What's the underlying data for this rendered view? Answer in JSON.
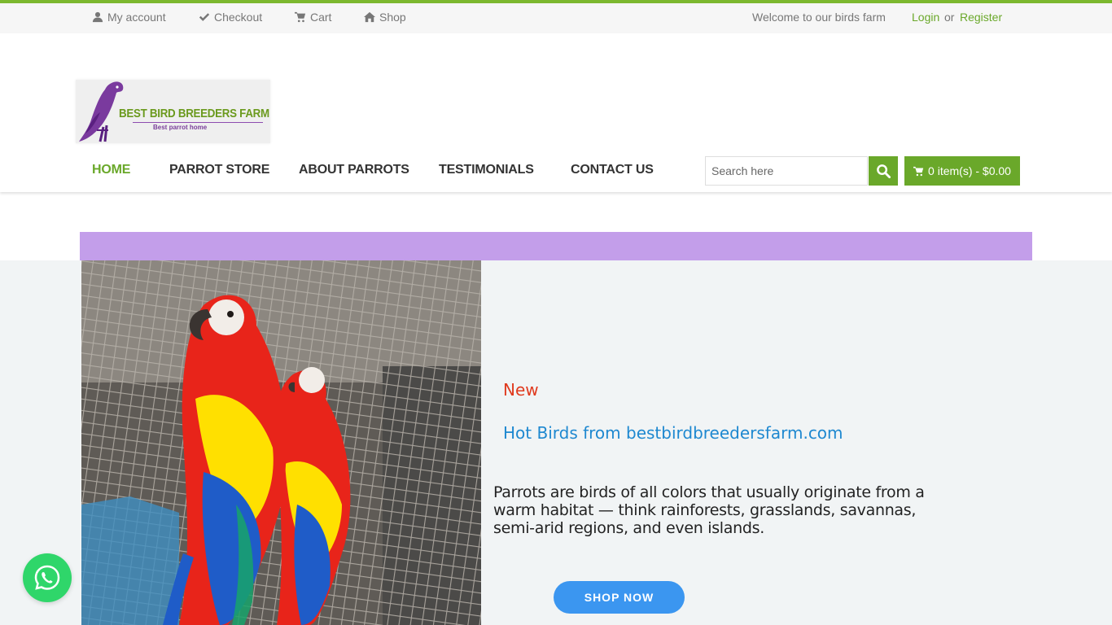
{
  "topbar": {
    "my_account": "My account",
    "checkout": "Checkout",
    "cart": "Cart",
    "shop": "Shop",
    "welcome": "Welcome to our birds farm",
    "login": "Login",
    "or": "or",
    "register": "Register"
  },
  "logo": {
    "title": "BEST BIRD BREEDERS FARM",
    "tagline": "Best parrot home"
  },
  "nav": {
    "items": [
      {
        "label": "HOME",
        "active": true
      },
      {
        "label": "PARROT STORE",
        "active": false
      },
      {
        "label": "ABOUT PARROTS",
        "active": false
      },
      {
        "label": "TESTIMONIALS",
        "active": false
      },
      {
        "label": "CONTACT US",
        "active": false
      }
    ]
  },
  "search": {
    "placeholder": "Search here"
  },
  "cart": {
    "summary": "0 item(s) - $0.00"
  },
  "hero": {
    "new_label": "New",
    "hot_label": "Hot Birds from bestbirdbreedersfarm.com",
    "description": "Parrots are birds of all colors that usually originate from a warm habitat — think rainforests, grasslands, savannas, semi-arid regions, and even islands.",
    "shop_button": "SHOP NOW"
  },
  "colors": {
    "accent_green": "#6aa82a",
    "band_purple": "#c39eea",
    "new_red": "#e03a1e",
    "link_blue": "#1e88d0",
    "button_blue": "#3b96f0",
    "whatsapp_green": "#2fd66a"
  },
  "icons": {
    "my_account": "user-icon",
    "checkout": "check-icon",
    "cart": "cart-icon",
    "shop": "home-icon",
    "search": "search-icon",
    "whatsapp": "whatsapp-icon"
  }
}
